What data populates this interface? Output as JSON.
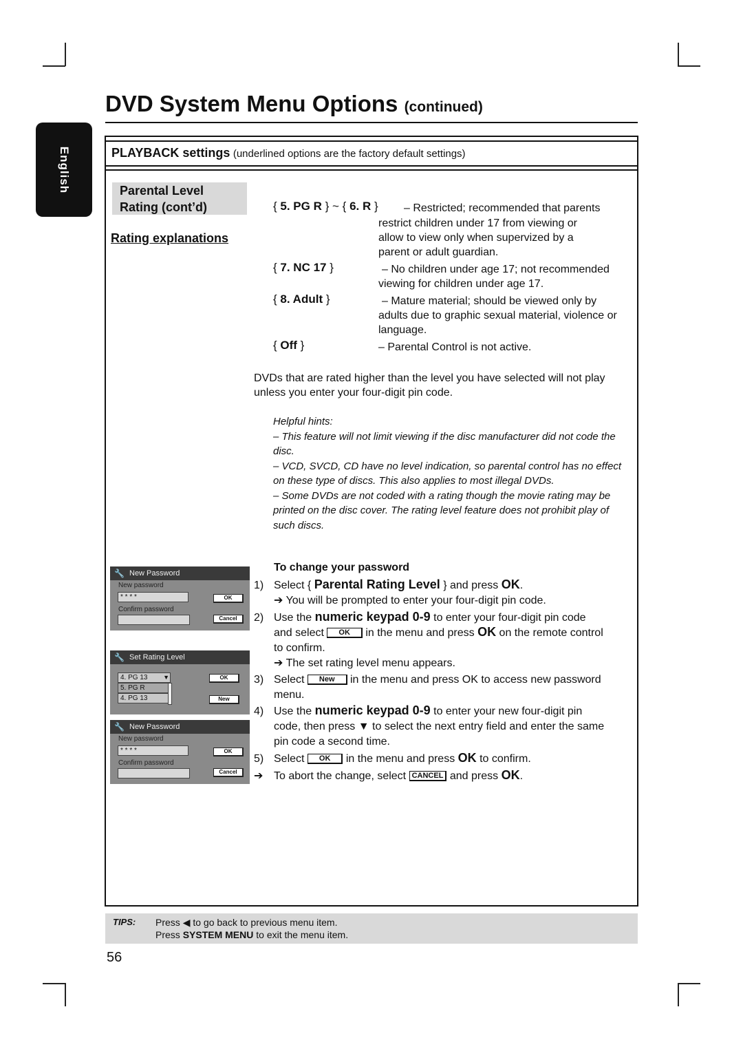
{
  "title": {
    "main": "DVD System Menu Options",
    "suffix": "(continued)"
  },
  "language_tab": "English",
  "section": {
    "label": "PLAYBACK settings",
    "note": "(underlined options are the factory default settings)"
  },
  "sidebar_box": {
    "line1": "Parental Level",
    "line2": "Rating (cont’d)"
  },
  "subheading": "Rating explanations",
  "ratings": [
    {
      "pre": "{ ",
      "key": "5. PG R",
      "mid": " } ~ { ",
      "key2": "6. R",
      "post": " }",
      "lines": [
        "– Restricted; recommended that parents",
        "restrict children under 17 from viewing or",
        "allow to view only when supervized by a",
        "parent or adult guardian."
      ]
    },
    {
      "pre": "{ ",
      "key": "7. NC 17",
      "post": " }",
      "lines": [
        "– No children under age 17; not recommended",
        "viewing for children under age 17."
      ]
    },
    {
      "pre": "{ ",
      "key": "8. Adult",
      "post": " }",
      "lines": [
        "– Mature material; should be viewed only by",
        "adults due to graphic sexual material, violence or",
        "language."
      ]
    },
    {
      "pre": "{ ",
      "key": "Off",
      "post": " }",
      "lines": [
        "– Parental Control is not active."
      ]
    }
  ],
  "note_lines": [
    "DVDs that are rated higher than the level you have selected will not play",
    "unless you enter your four-digit pin code."
  ],
  "hints": {
    "title": "Helpful hints:",
    "lines": [
      "– This feature will not limit viewing if the disc manufacturer did not code the",
      "disc.",
      "– VCD, SVCD, CD have no level indication, so parental control has no effect",
      "on these type of discs. This also applies to most illegal DVDs.",
      "– Some DVDs are not coded with a rating though the movie rating may be",
      "printed on the disc cover. The rating level feature does not prohibit play of",
      "such discs."
    ]
  },
  "password": {
    "heading": "To change your password",
    "s1": {
      "n": "1)",
      "a": "Select { ",
      "b": "Parental Rating Level",
      "c": " } and press ",
      "d": "OK",
      "e": ".",
      "arrow": "You will be prompted to enter your four-digit pin code."
    },
    "s2": {
      "n": "2)",
      "a": "Use the ",
      "b": "numeric keypad 0-9",
      "c": " to enter your four-digit pin code",
      "d": "and select ",
      "btn": "OK",
      "e": " in the menu and press ",
      "f": "OK",
      "g": " on the remote control",
      "h": "to confirm.",
      "arrow": "The set rating level menu appears."
    },
    "s3": {
      "n": "3)",
      "a": "Select ",
      "btn": "New",
      "b": " in the menu and press OK to access new password",
      "c": "menu."
    },
    "s4": {
      "n": "4)",
      "a": "Use the ",
      "b": "numeric keypad 0-9",
      "c": " to enter your new four-digit pin",
      "d": "code, then press ",
      "e": " to select the next entry field and enter the same",
      "f": "pin code a second time."
    },
    "s5": {
      "n": "5)",
      "a": "Select ",
      "btn": "OK",
      "b": " in the menu and press ",
      "c": "OK",
      "d": " to confirm."
    },
    "abort": {
      "a": "To abort the change, select ",
      "btn": "CANCEL",
      "b": " and press ",
      "c": "OK",
      "d": "."
    }
  },
  "screens": {
    "new_password": {
      "title": "New Password",
      "new_label": "New password",
      "value": "* * * *",
      "confirm_label": "Confirm password",
      "ok": "OK",
      "cancel": "Cancel"
    },
    "set_rating": {
      "title": "Set Rating Level",
      "selected": "4.  PG 13",
      "options": [
        "5.  PG R",
        "4.  PG 13"
      ],
      "ok": "OK",
      "new": "New"
    }
  },
  "tips": {
    "label": "TIPS:",
    "l1a": "Press ",
    "l1b": " to go back to previous menu item.",
    "l2a": "Press ",
    "l2b": "SYSTEM MENU",
    "l2c": " to exit the menu item."
  },
  "page_number": "56"
}
